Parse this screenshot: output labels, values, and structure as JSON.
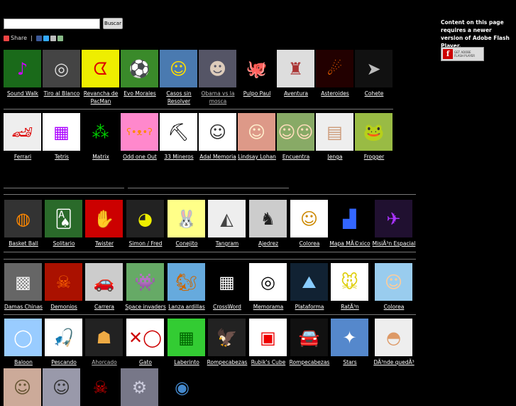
{
  "search": {
    "placeholder": "",
    "button_label": "Buscar"
  },
  "share": {
    "label": "Share"
  },
  "flash": {
    "message": "Content on this page requires a newer version of Adobe Flash Player.",
    "badge_top": "GET ADOBE",
    "badge_bottom": "FLASH PLAYER"
  },
  "rows": [
    [
      {
        "label": "Sound Walk",
        "icon": "soundwalk-icon",
        "bg": "#1a6a1a",
        "fg": "#c0f",
        "glyph": "♪"
      },
      {
        "label": "Tiro al Blanco",
        "icon": "target-icon",
        "bg": "#444",
        "fg": "#ddd",
        "glyph": "◎"
      },
      {
        "label": "Revancha de PacMan",
        "icon": "pacman-icon",
        "bg": "#ee0",
        "fg": "#d00",
        "glyph": "ᗧ"
      },
      {
        "label": "Evo Morales",
        "icon": "soccer-icon",
        "bg": "#3a8a2a",
        "fg": "#fff",
        "glyph": "⚽"
      },
      {
        "label": "Casos sin Resolver",
        "icon": "player-icon",
        "bg": "#4a7ab0",
        "fg": "#fd0",
        "glyph": "☺"
      },
      {
        "label": "Obama vs la mosca",
        "icon": "obama-icon",
        "bg": "#556",
        "fg": "#dcb",
        "glyph": "☻",
        "dim": true
      },
      {
        "label": "Pulpo Paul",
        "icon": "octopus-icon",
        "bg": "#000",
        "fg": "#d96",
        "glyph": "🐙"
      },
      {
        "label": "Aventura",
        "icon": "adventure-icon",
        "bg": "#ddd",
        "fg": "#a33",
        "glyph": "♜"
      },
      {
        "label": "Asteroides",
        "icon": "asteroid-icon",
        "bg": "#200",
        "fg": "#f60",
        "glyph": "☄"
      },
      {
        "label": "Cohete",
        "icon": "rocket-icon",
        "bg": "#111",
        "fg": "#bbb",
        "glyph": "➤"
      }
    ],
    [
      {
        "label": "Ferrari",
        "icon": "ferrari-icon",
        "bg": "#eee",
        "fg": "#d00",
        "glyph": "🏎"
      },
      {
        "label": "Tetris",
        "icon": "tetris-icon",
        "bg": "#fff",
        "fg": "#a0f",
        "glyph": "▦"
      },
      {
        "label": "Matrix",
        "icon": "matrix-icon",
        "bg": "#000",
        "fg": "#0c0",
        "glyph": "⁂"
      },
      {
        "label": "Odd one Out",
        "icon": "bear-icon",
        "bg": "#f8c",
        "fg": "#f80",
        "glyph": "ʕ•ᴥ•ʔ"
      },
      {
        "label": "33 Mineros",
        "icon": "miners-icon",
        "bg": "#fff",
        "fg": "#000",
        "glyph": "⛏"
      },
      {
        "label": "Adal Memoria",
        "icon": "portrait-icon",
        "bg": "#fff",
        "fg": "#333",
        "glyph": "☺"
      },
      {
        "label": "Lindsay Lohan",
        "icon": "lohan-icon",
        "bg": "#d98",
        "fg": "#fec",
        "glyph": "☺"
      },
      {
        "label": "Encuentra",
        "icon": "crowd-icon",
        "bg": "#8a6",
        "fg": "#fdb",
        "glyph": "☺☺"
      },
      {
        "label": "Jenga",
        "icon": "jenga-icon",
        "bg": "#eee",
        "fg": "#c97",
        "glyph": "▤"
      },
      {
        "label": "Frogger",
        "icon": "frog-icon",
        "bg": "#9b4",
        "fg": "#2a2",
        "glyph": "🐸"
      }
    ],
    [
      {
        "label": "Basket Ball",
        "icon": "basketball-icon",
        "bg": "#333",
        "fg": "#f80",
        "glyph": "◍"
      },
      {
        "label": "Solitario",
        "icon": "solitaire-icon",
        "bg": "#2a6a2a",
        "fg": "#fff",
        "glyph": "🂡"
      },
      {
        "label": "Twister",
        "icon": "twister-icon",
        "bg": "#c00",
        "fg": "#0a0",
        "glyph": "✋"
      },
      {
        "label": "Simon / Fred",
        "icon": "simon-icon",
        "bg": "#222",
        "fg": "#ee0",
        "glyph": "◕"
      },
      {
        "label": "Conejito",
        "icon": "bunny-icon",
        "bg": "#ff8",
        "fg": "#4af",
        "glyph": "🐰"
      },
      {
        "label": "Tangram",
        "icon": "tangram-icon",
        "bg": "#eee",
        "fg": "#444",
        "glyph": "◭"
      },
      {
        "label": "Ajedrez",
        "icon": "chess-icon",
        "bg": "#ccc",
        "fg": "#222",
        "glyph": "♞"
      },
      {
        "label": "Colorea",
        "icon": "clown-icon",
        "bg": "#fff",
        "fg": "#c80",
        "glyph": "☺"
      },
      {
        "label": "Mapa MÃ©xico",
        "icon": "map-icon",
        "bg": "#000",
        "fg": "#36f",
        "glyph": "▟"
      },
      {
        "label": "MisiÃ³n Espacial",
        "icon": "spaceship-icon",
        "bg": "#201030",
        "fg": "#a3f",
        "glyph": "✈"
      }
    ],
    [
      {
        "label": "Damas Chinas",
        "icon": "checkers-icon",
        "bg": "#666",
        "fg": "#eee",
        "glyph": "▩"
      },
      {
        "label": "Demonios",
        "icon": "demon-icon",
        "bg": "#a10",
        "fg": "#f60",
        "glyph": "☠"
      },
      {
        "label": "Carrera",
        "icon": "race-icon",
        "bg": "#ccc",
        "fg": "#333",
        "glyph": "🚗"
      },
      {
        "label": "Space invaders",
        "icon": "invaders-icon",
        "bg": "#6a6",
        "fg": "#cec",
        "glyph": "👾"
      },
      {
        "label": "Lanza ardillas",
        "icon": "squirrel-icon",
        "bg": "#6ad",
        "fg": "#c60",
        "glyph": "🐿"
      },
      {
        "label": "CrossWord",
        "icon": "crossword-icon",
        "bg": "#000",
        "fg": "#fff",
        "glyph": "▦"
      },
      {
        "label": "Memorama",
        "icon": "spiral-icon",
        "bg": "#fff",
        "fg": "#000",
        "glyph": "◎"
      },
      {
        "label": "Plataforma",
        "icon": "platform-icon",
        "bg": "#123",
        "fg": "#8cf",
        "glyph": "⛰"
      },
      {
        "label": "RatÃ³n",
        "icon": "mouse-icon",
        "bg": "#fff",
        "fg": "#dc0",
        "glyph": "🐭"
      },
      {
        "label": "Colorea",
        "icon": "girl-icon",
        "bg": "#9ce",
        "fg": "#fc9",
        "glyph": "☺"
      }
    ],
    [
      {
        "label": "Baloon",
        "icon": "balloon-icon",
        "bg": "#9cf",
        "fg": "#fff",
        "glyph": "◯"
      },
      {
        "label": "Pescando",
        "icon": "fishing-icon",
        "bg": "#fff",
        "fg": "#a63",
        "glyph": "🎣"
      },
      {
        "label": "Ahorcado",
        "icon": "hangman-icon",
        "bg": "#222",
        "fg": "#ea4",
        "glyph": "☗",
        "dim": true
      },
      {
        "label": "Gato",
        "icon": "tictactoe-icon",
        "bg": "#fff",
        "fg": "#c00",
        "glyph": "✕◯"
      },
      {
        "label": "Laberinto",
        "icon": "maze-icon",
        "bg": "#3c3",
        "fg": "#060",
        "glyph": "▦"
      },
      {
        "label": "Rompecabezas",
        "icon": "eagle-icon",
        "bg": "#222",
        "fg": "#b87",
        "glyph": "🦅"
      },
      {
        "label": "Rubik's Cube",
        "icon": "rubik-icon",
        "bg": "#fff",
        "fg": "#e00",
        "glyph": "▣"
      },
      {
        "label": "Rompecabezas",
        "icon": "car-icon",
        "bg": "#111",
        "fg": "#d00",
        "glyph": "🚘"
      },
      {
        "label": "Stars",
        "icon": "stars-icon",
        "bg": "#58c",
        "fg": "#fff",
        "glyph": "✦"
      },
      {
        "label": "DÃ³nde quedÃ³",
        "icon": "shell-icon",
        "bg": "#eee",
        "fg": "#d96",
        "glyph": "◓"
      }
    ],
    [
      {
        "label": "",
        "icon": "woman-icon",
        "bg": "#ca9",
        "fg": "#653",
        "glyph": "☺"
      },
      {
        "label": "",
        "icon": "person-icon",
        "bg": "#99a",
        "fg": "#333",
        "glyph": "☺"
      },
      {
        "label": "",
        "icon": "devil-icon",
        "bg": "#000",
        "fg": "#d00",
        "glyph": "☠"
      },
      {
        "label": "",
        "icon": "robot-icon",
        "bg": "#778",
        "fg": "#ccd",
        "glyph": "⚙"
      },
      {
        "label": "",
        "icon": "earth-icon",
        "bg": "#000",
        "fg": "#48c",
        "glyph": "◉"
      }
    ]
  ]
}
